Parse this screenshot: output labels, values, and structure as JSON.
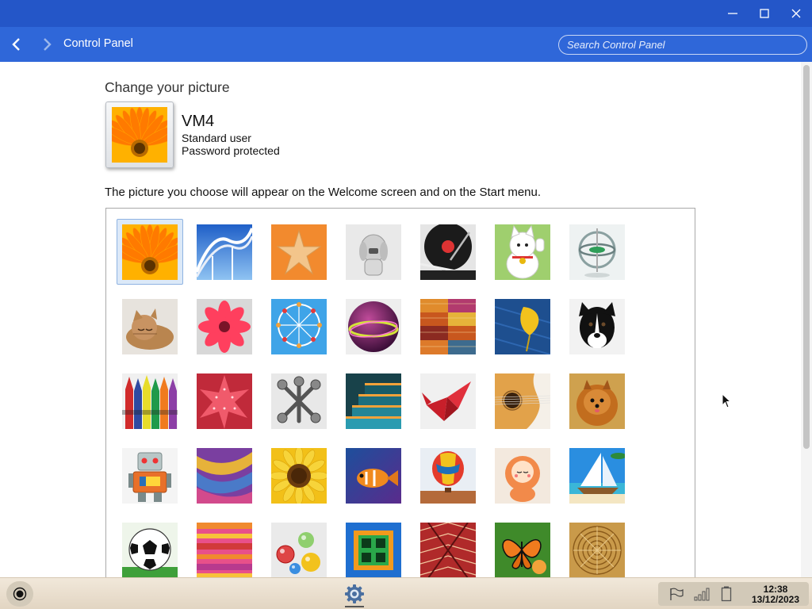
{
  "window": {
    "controls": {
      "minimize_icon": "minimize-icon",
      "maximize_icon": "maximize-icon",
      "close_icon": "close-icon"
    }
  },
  "nav": {
    "title": "Control Panel",
    "search_placeholder": "Search Control Panel"
  },
  "page": {
    "heading": "Change your picture",
    "user": {
      "name": "VM4",
      "type": "Standard user",
      "password_status": "Password protected"
    },
    "description": "The picture you choose will appear on the Welcome screen and on the Start menu.",
    "selected_picture": "flower-orange"
  },
  "pictures": [
    [
      "flower-orange",
      "roller-coaster",
      "starfish",
      "robot-dog",
      "turntable",
      "lucky-cat",
      "gyroscope"
    ],
    [
      "kitten",
      "flower-pink",
      "ferris-wheel",
      "ball",
      "textile",
      "leaf",
      "dog-border-collie"
    ],
    [
      "crayons",
      "star-lantern",
      "jack",
      "stairs",
      "origami-crane",
      "guitar",
      "dog-pomeranian"
    ],
    [
      "toy-robot",
      "scarves",
      "sunflower",
      "fish",
      "hot-air-balloon",
      "doll",
      "sailboat"
    ],
    [
      "soccer-ball",
      "fabric-stripes",
      "marbles",
      "window",
      "rug",
      "butterfly",
      "basket"
    ]
  ],
  "taskbar": {
    "start_icon": "start-icon",
    "app_icon": "settings-gear-icon",
    "tray_icons": [
      "flag-icon",
      "network-icon",
      "battery-icon"
    ],
    "time": "12:38",
    "date": "13/12/2023"
  },
  "colors": {
    "titlebar": "#2456c8",
    "navbar": "#2f67d9",
    "taskbar": "#efe6d8"
  }
}
